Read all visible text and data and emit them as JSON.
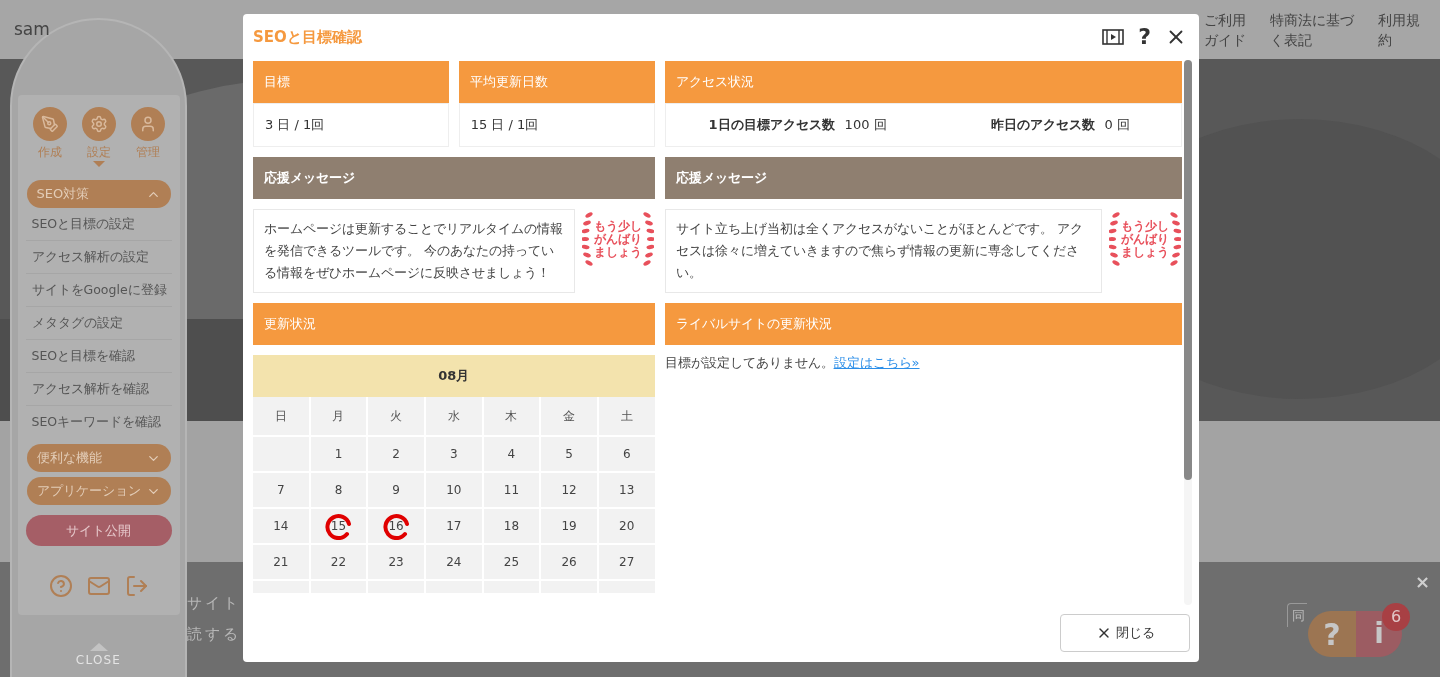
{
  "page": {
    "site_name": "sam",
    "nav": [
      {
        "label": "ご利用ガイド"
      },
      {
        "label": "特商法に基づく表記"
      },
      {
        "label": "利用規約"
      }
    ],
    "fragments": [
      "サイト",
      "読する"
    ],
    "consent_button": "同",
    "banner_close": "×"
  },
  "sidebar": {
    "tabs": [
      {
        "label": "作成",
        "selected": false
      },
      {
        "label": "設定",
        "selected": true
      },
      {
        "label": "管理",
        "selected": false
      }
    ],
    "sections": [
      {
        "label": "SEO対策",
        "expanded": true,
        "items": [
          "SEOと目標の設定",
          "アクセス解析の設定",
          "サイトをGoogleに登録",
          "メタタグの設定",
          "SEOと目標を確認",
          "アクセス解析を確認",
          "SEOキーワードを確認"
        ]
      },
      {
        "label": "便利な機能",
        "expanded": false
      },
      {
        "label": "アプリケーション",
        "expanded": false
      }
    ],
    "publish_button": "サイト公開",
    "close_label": "CLOSE"
  },
  "modal": {
    "title": "SEOと目標確認",
    "help_glyph": "?",
    "summary_cards": [
      {
        "heading": "目標",
        "value": "3 日 / 1回"
      },
      {
        "heading": "平均更新日数",
        "value": "15 日 / 1回"
      }
    ],
    "access": {
      "heading": "アクセス状況",
      "stats": [
        {
          "label": "1日の目標アクセス数",
          "value": "100 回"
        },
        {
          "label": "昨日のアクセス数",
          "value": "0 回"
        }
      ]
    },
    "messages": [
      {
        "heading": "応援メッセージ",
        "text": "ホームページは更新することでリアルタイムの情報を発信できるツールです。 今のあなたの持っている情報をぜひホームページに反映させましょう！",
        "stamp": [
          "もう少し",
          "がんばり",
          "ましょう"
        ]
      },
      {
        "heading": "応援メッセージ",
        "text": "サイト立ち上げ当初は全くアクセスがないことがほとんどです。 アクセスは徐々に増えていきますので焦らず情報の更新に専念してください。",
        "stamp": [
          "もう少し",
          "がんばり",
          "ましょう"
        ]
      }
    ],
    "calendar": {
      "heading": "更新状況",
      "month": "08月",
      "weekdays": [
        "日",
        "月",
        "火",
        "水",
        "木",
        "金",
        "土"
      ],
      "weeks": [
        [
          {
            "kind": "blank",
            "marked": false
          },
          {
            "kind": "day",
            "day": "1",
            "marked": false
          },
          {
            "kind": "day",
            "day": "2",
            "marked": false
          },
          {
            "kind": "day",
            "day": "3",
            "marked": false
          },
          {
            "kind": "day",
            "day": "4",
            "marked": false
          },
          {
            "kind": "day",
            "day": "5",
            "marked": false
          },
          {
            "kind": "day",
            "day": "6",
            "marked": false
          }
        ],
        [
          {
            "kind": "day",
            "day": "7",
            "marked": false
          },
          {
            "kind": "day",
            "day": "8",
            "marked": false
          },
          {
            "kind": "day",
            "day": "9",
            "marked": false
          },
          {
            "kind": "day",
            "day": "10",
            "marked": false
          },
          {
            "kind": "day",
            "day": "11",
            "marked": false
          },
          {
            "kind": "day",
            "day": "12",
            "marked": false
          },
          {
            "kind": "day",
            "day": "13",
            "marked": false
          }
        ],
        [
          {
            "kind": "day",
            "day": "14",
            "marked": false
          },
          {
            "kind": "day",
            "day": "15",
            "marked": true
          },
          {
            "kind": "day",
            "day": "16",
            "marked": true
          },
          {
            "kind": "day",
            "day": "17",
            "marked": false
          },
          {
            "kind": "day",
            "day": "18",
            "marked": false
          },
          {
            "kind": "day",
            "day": "19",
            "marked": false
          },
          {
            "kind": "day",
            "day": "20",
            "marked": false
          }
        ],
        [
          {
            "kind": "day",
            "day": "21",
            "marked": false
          },
          {
            "kind": "day",
            "day": "22",
            "marked": false
          },
          {
            "kind": "day",
            "day": "23",
            "marked": false
          },
          {
            "kind": "day",
            "day": "24",
            "marked": false
          },
          {
            "kind": "day",
            "day": "25",
            "marked": false
          },
          {
            "kind": "day",
            "day": "26",
            "marked": false
          },
          {
            "kind": "day",
            "day": "27",
            "marked": false
          }
        ]
      ]
    },
    "rival": {
      "heading": "ライバルサイトの更新状況",
      "text": "目標が設定してありません。",
      "link": "設定はこちら»"
    },
    "close_button": "閉じる"
  },
  "help_widget": {
    "help": "?",
    "info": "i",
    "badge": "6"
  }
}
